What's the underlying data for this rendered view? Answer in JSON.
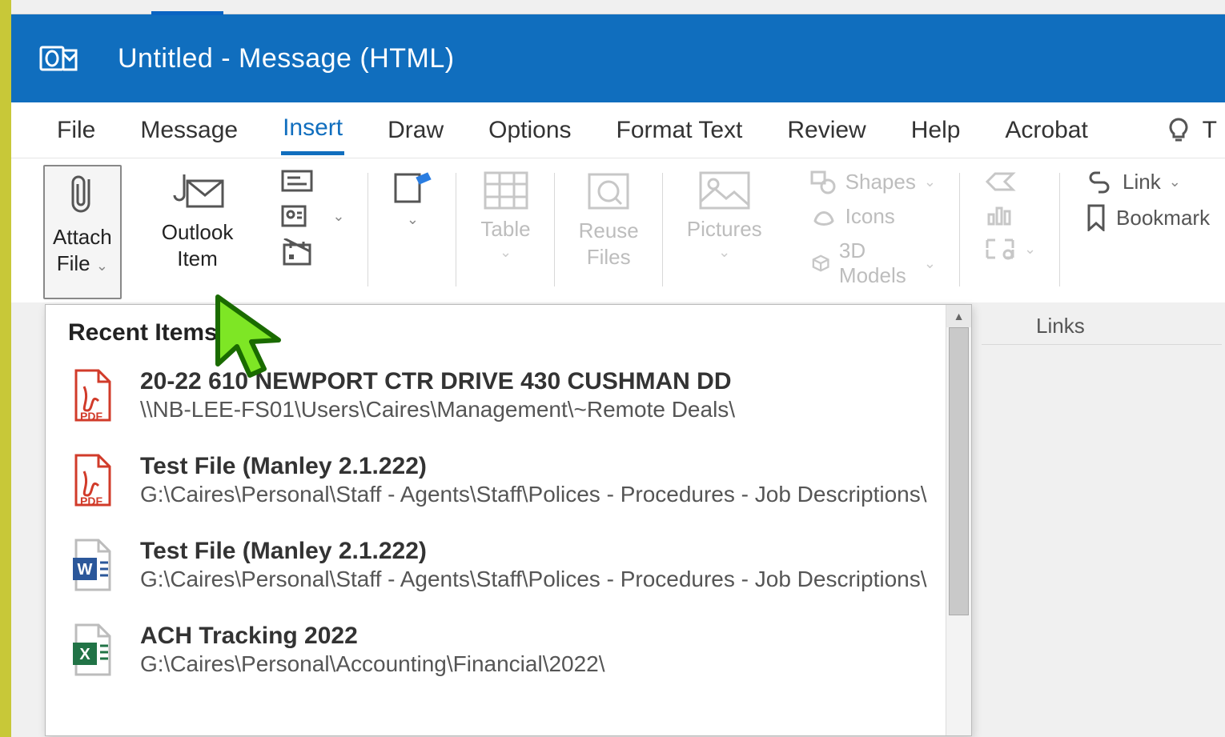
{
  "title": "Untitled  -  Message (HTML)",
  "tabs": {
    "file": "File",
    "message": "Message",
    "insert": "Insert",
    "draw": "Draw",
    "options": "Options",
    "format_text": "Format Text",
    "review": "Review",
    "help": "Help",
    "acrobat": "Acrobat",
    "tell_me": "T"
  },
  "ribbon": {
    "attach_file": "Attach\nFile",
    "outlook_item": "Outlook\nItem",
    "table": "Table",
    "reuse_files": "Reuse\nFiles",
    "pictures": "Pictures",
    "shapes": "Shapes",
    "icons": "Icons",
    "models": "3D Models",
    "link": "Link",
    "bookmark": "Bookmark",
    "links_group": "Links"
  },
  "dropdown": {
    "header": "Recent Items",
    "items": [
      {
        "type": "pdf",
        "name": "20-22 610 NEWPORT CTR DRIVE 430 CUSHMAN DD",
        "path": "\\\\NB-LEE-FS01\\Users\\Caires\\Management\\~Remote Deals\\"
      },
      {
        "type": "pdf",
        "name": "Test File (Manley 2.1.222)",
        "path": "G:\\Caires\\Personal\\Staff - Agents\\Staff\\Polices - Procedures - Job Descriptions\\"
      },
      {
        "type": "word",
        "name": "Test File (Manley 2.1.222)",
        "path": "G:\\Caires\\Personal\\Staff - Agents\\Staff\\Polices - Procedures - Job Descriptions\\"
      },
      {
        "type": "excel",
        "name": "ACH Tracking  2022",
        "path": "G:\\Caires\\Personal\\Accounting\\Financial\\2022\\"
      }
    ]
  }
}
